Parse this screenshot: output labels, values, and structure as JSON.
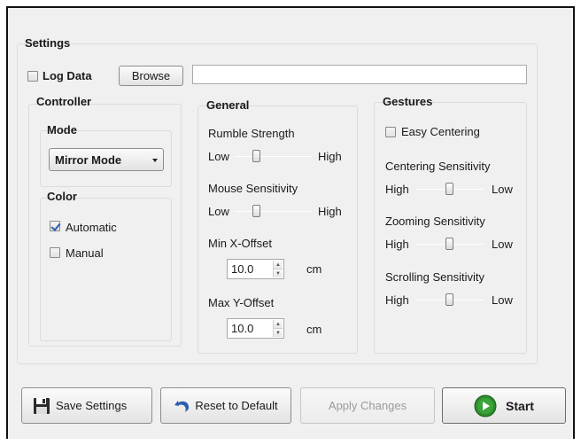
{
  "settings": {
    "title": "Settings",
    "log_data_label": "Log Data",
    "log_data_checked": false,
    "browse_label": "Browse",
    "path_value": ""
  },
  "controller": {
    "title": "Controller",
    "mode": {
      "title": "Mode",
      "selected": "Mirror Mode"
    },
    "color": {
      "title": "Color",
      "automatic_label": "Automatic",
      "automatic_checked": true,
      "manual_label": "Manual",
      "manual_checked": false
    }
  },
  "general": {
    "title": "General",
    "rumble": {
      "label": "Rumble Strength",
      "low": "Low",
      "high": "High",
      "level": 0.25
    },
    "mouse": {
      "label": "Mouse Sensitivity",
      "low": "Low",
      "high": "High",
      "level": 0.25
    },
    "min_x": {
      "label": "Min X-Offset",
      "value": "10.0",
      "unit": "cm"
    },
    "max_y": {
      "label": "Max Y-Offset",
      "value": "10.0",
      "unit": "cm"
    }
  },
  "gestures": {
    "title": "Gestures",
    "easy_centering_label": "Easy Centering",
    "easy_centering_checked": false,
    "centering": {
      "label": "Centering Sensitivity",
      "left": "High",
      "right": "Low",
      "level": 0.5
    },
    "zooming": {
      "label": "Zooming Sensitivity",
      "left": "High",
      "right": "Low",
      "level": 0.5
    },
    "scrolling": {
      "label": "Scrolling Sensitivity",
      "left": "High",
      "right": "Low",
      "level": 0.5
    }
  },
  "footer": {
    "save_label": "Save Settings",
    "reset_label": "Reset to Default",
    "apply_label": "Apply Changes",
    "start_label": "Start"
  },
  "colors": {
    "start_green": "#2e8b2e",
    "reset_blue": "#2a5fb0"
  }
}
